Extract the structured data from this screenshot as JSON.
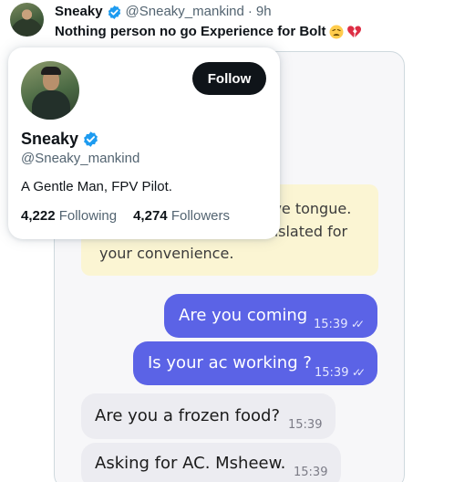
{
  "tweet": {
    "author_name": "Sneaky",
    "handle": "@Sneaky_mankind",
    "separator": "·",
    "time": "9h",
    "text": "Nothing person no go Experience for Bolt",
    "emojis": [
      "weary-face",
      "broken-heart"
    ]
  },
  "hover_card": {
    "follow_label": "Follow",
    "name": "Sneaky",
    "handle": "@Sneaky_mankind",
    "bio": "A Gentle Man, FPV Pilot.",
    "following_count": "4,222",
    "following_label": "Following",
    "followers_count": "4,274",
    "followers_label": "Followers"
  },
  "chat": {
    "notice_lines": [
      "ive tongue.",
      "nslated for",
      "your convenience."
    ],
    "messages": [
      {
        "direction": "out",
        "text": "Are you coming",
        "time": "15:39"
      },
      {
        "direction": "out",
        "text": "Is your ac working ?",
        "time": "15:39"
      },
      {
        "direction": "in",
        "text": "Are you a frozen food?",
        "time": "15:39"
      },
      {
        "direction": "in",
        "text": "Asking for AC. Msheew.",
        "time": "15:39"
      }
    ]
  },
  "colors": {
    "verified": "#1d9bf0",
    "follow_button": "#0f1419",
    "outgoing_bubble": "#5b63e6",
    "incoming_bubble": "#ececf1",
    "notice_bg": "#fbf5d3"
  }
}
